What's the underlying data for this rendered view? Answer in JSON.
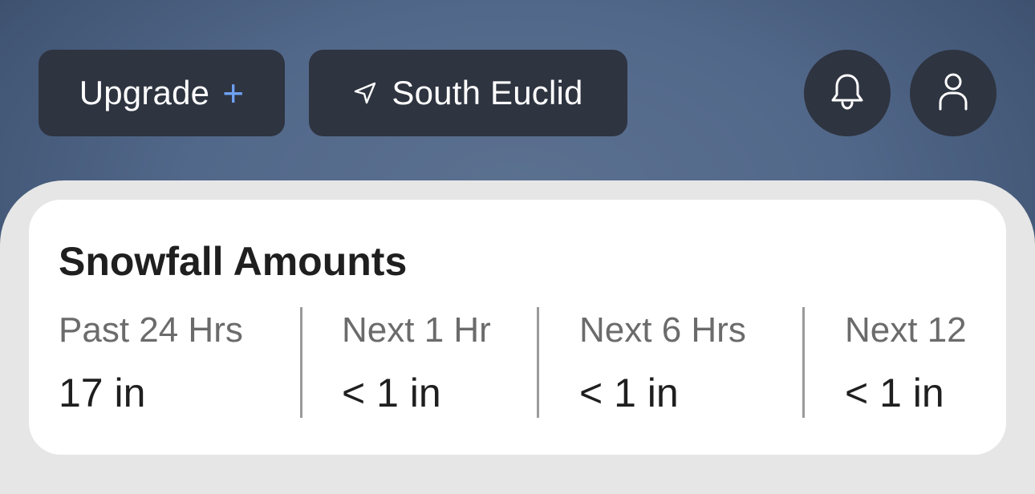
{
  "header": {
    "upgrade_label": "Upgrade",
    "upgrade_plus": "+",
    "location_label": "South Euclid"
  },
  "icons": {
    "location": "navigation-arrow-icon",
    "notifications": "bell-icon",
    "profile": "user-icon"
  },
  "colors": {
    "plus_accent": "#6ea1f2",
    "button_bg": "#2e3440"
  },
  "snowfall": {
    "title": "Snowfall Amounts",
    "stats": [
      {
        "label": "Past 24 Hrs",
        "value": "17 in"
      },
      {
        "label": "Next 1 Hr",
        "value": "< 1 in"
      },
      {
        "label": "Next 6 Hrs",
        "value": "< 1 in"
      },
      {
        "label": "Next 12",
        "value": "< 1 in"
      }
    ]
  }
}
